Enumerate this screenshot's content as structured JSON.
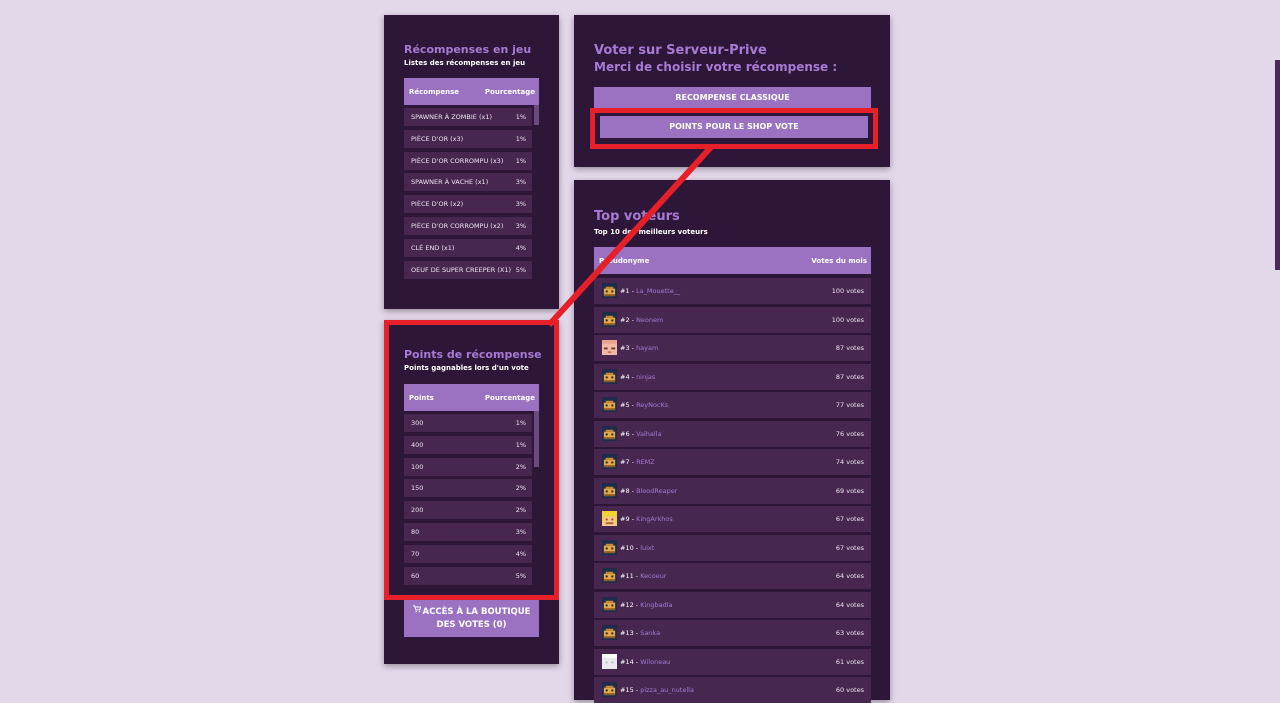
{
  "rewards": {
    "title": "Récompenses en jeu",
    "subtitle": "Listes des récompenses en jeu",
    "header": {
      "col1": "Récompense",
      "col2": "Pourcentage"
    },
    "rows": [
      {
        "name": "SPAWNER À ZOMBIE (x1)",
        "pct": "1%"
      },
      {
        "name": "PIÈCE D'OR (x3)",
        "pct": "1%"
      },
      {
        "name": "PIÈCE D'OR CORROMPU (x3)",
        "pct": "1%"
      },
      {
        "name": "SPAWNER À VACHE (x1)",
        "pct": "3%"
      },
      {
        "name": "PIÈCE D'OR (x2)",
        "pct": "3%"
      },
      {
        "name": "PIÈCE D'OR CORROMPU (x2)",
        "pct": "3%"
      },
      {
        "name": "CLÉ END (x1)",
        "pct": "4%"
      },
      {
        "name": "OEUF DE SUPER CREEPER (X1)",
        "pct": "5%"
      }
    ]
  },
  "points": {
    "title": "Points de récompense",
    "subtitle": "Points gagnables lors d'un vote",
    "header": {
      "col1": "Points",
      "col2": "Pourcentage"
    },
    "rows": [
      {
        "name": "300",
        "pct": "1%"
      },
      {
        "name": "400",
        "pct": "1%"
      },
      {
        "name": "100",
        "pct": "2%"
      },
      {
        "name": "150",
        "pct": "2%"
      },
      {
        "name": "200",
        "pct": "2%"
      },
      {
        "name": "80",
        "pct": "3%"
      },
      {
        "name": "70",
        "pct": "4%"
      },
      {
        "name": "60",
        "pct": "5%"
      }
    ]
  },
  "shop_button": {
    "icon": "cart-icon",
    "line1": "ACCÈS À LA BOUTIQUE",
    "line2": "DES VOTES (0)"
  },
  "vote": {
    "title1": "Voter sur Serveur-Prive",
    "title2": "Merci de choisir votre récompense :",
    "button_classic": "RECOMPENSE CLASSIQUE",
    "button_shop": "POINTS POUR LE SHOP VOTE"
  },
  "top": {
    "title": "Top voteurs",
    "subtitle": "Top 10 des meilleurs voteurs",
    "header": {
      "col1": "Pseudonyme",
      "col2": "Votes du mois"
    },
    "rows": [
      {
        "rank": "#1 - ",
        "pseudo": "La_Mouette__",
        "votes": "100 votes",
        "avatar": "default"
      },
      {
        "rank": "#2 - ",
        "pseudo": "Neonem",
        "votes": "100 votes",
        "avatar": "default"
      },
      {
        "rank": "#3 - ",
        "pseudo": "hayam",
        "votes": "87 votes",
        "avatar": "pink"
      },
      {
        "rank": "#4 - ",
        "pseudo": "ninjas",
        "votes": "87 votes",
        "avatar": "default"
      },
      {
        "rank": "#5 - ",
        "pseudo": "ReyNocKs",
        "votes": "77 votes",
        "avatar": "default"
      },
      {
        "rank": "#6 - ",
        "pseudo": "Valhalla",
        "votes": "76 votes",
        "avatar": "default"
      },
      {
        "rank": "#7 - ",
        "pseudo": "REMZ",
        "votes": "74 votes",
        "avatar": "default"
      },
      {
        "rank": "#8 - ",
        "pseudo": "BloodReaper",
        "votes": "69 votes",
        "avatar": "default"
      },
      {
        "rank": "#9 - ",
        "pseudo": "KingArkhos",
        "votes": "67 votes",
        "avatar": "blond"
      },
      {
        "rank": "#10 - ",
        "pseudo": "luixt",
        "votes": "67 votes",
        "avatar": "default"
      },
      {
        "rank": "#11 - ",
        "pseudo": "Kecoeur",
        "votes": "64 votes",
        "avatar": "default"
      },
      {
        "rank": "#12 - ",
        "pseudo": "Kingbadla",
        "votes": "64 votes",
        "avatar": "default"
      },
      {
        "rank": "#13 - ",
        "pseudo": "Sanka",
        "votes": "63 votes",
        "avatar": "default"
      },
      {
        "rank": "#14 - ",
        "pseudo": "Wiloneau",
        "votes": "61 votes",
        "avatar": "white"
      },
      {
        "rank": "#15 - ",
        "pseudo": "pizza_au_nutella",
        "votes": "60 votes",
        "avatar": "default"
      }
    ]
  },
  "colors": {
    "page_bg": "#e3d7ea",
    "card_bg": "#2d1637",
    "accent": "#9a72c1",
    "title": "#a77ad4",
    "highlight": "#e62029"
  }
}
